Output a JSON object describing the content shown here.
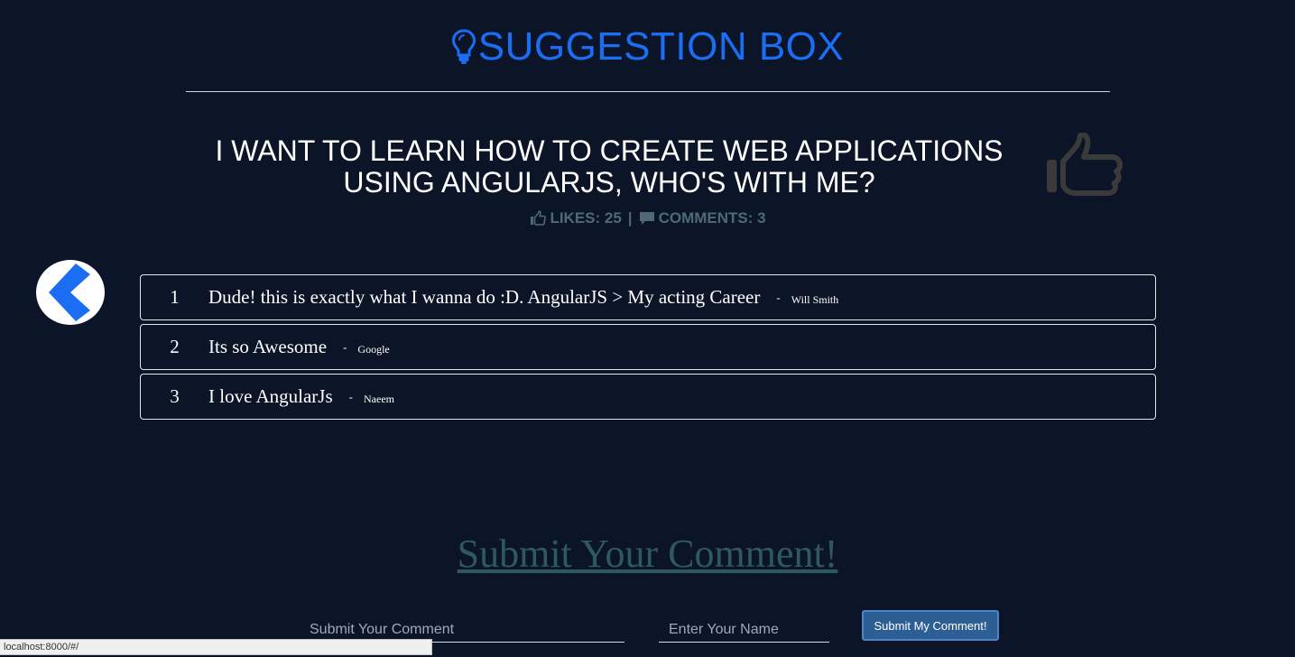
{
  "header": {
    "title": "SUGGESTION BOX",
    "icon": "lightbulb-icon",
    "accent_color": "#1b6ef3"
  },
  "topic": {
    "title": "I WANT TO LEARN HOW TO CREATE WEB APPLICATIONS USING ANGULARJS, WHO'S WITH ME?",
    "like_icon": "thumbs-up-icon"
  },
  "stats": {
    "likes_label": "LIKES: 25",
    "separator": "|",
    "comments_label": "COMMENTS: 3"
  },
  "navigation": {
    "back_icon": "chevron-left-icon"
  },
  "comments": [
    {
      "index": "1",
      "text": "Dude! this is exactly what I wanna do :D. AngularJS > My acting Career",
      "dash": "-",
      "author": "Will Smith"
    },
    {
      "index": "2",
      "text": "Its so Awesome",
      "dash": "-",
      "author": "Google"
    },
    {
      "index": "3",
      "text": "I love AngularJs",
      "dash": "-",
      "author": "Naeem"
    }
  ],
  "form": {
    "heading": "Submit Your Comment!",
    "comment_placeholder": "Submit Your Comment",
    "comment_value": "",
    "name_placeholder": "Enter Your Name",
    "name_value": "",
    "submit_label": "Submit My Comment!"
  },
  "status_bar": {
    "url": "localhost:8000/#/"
  }
}
